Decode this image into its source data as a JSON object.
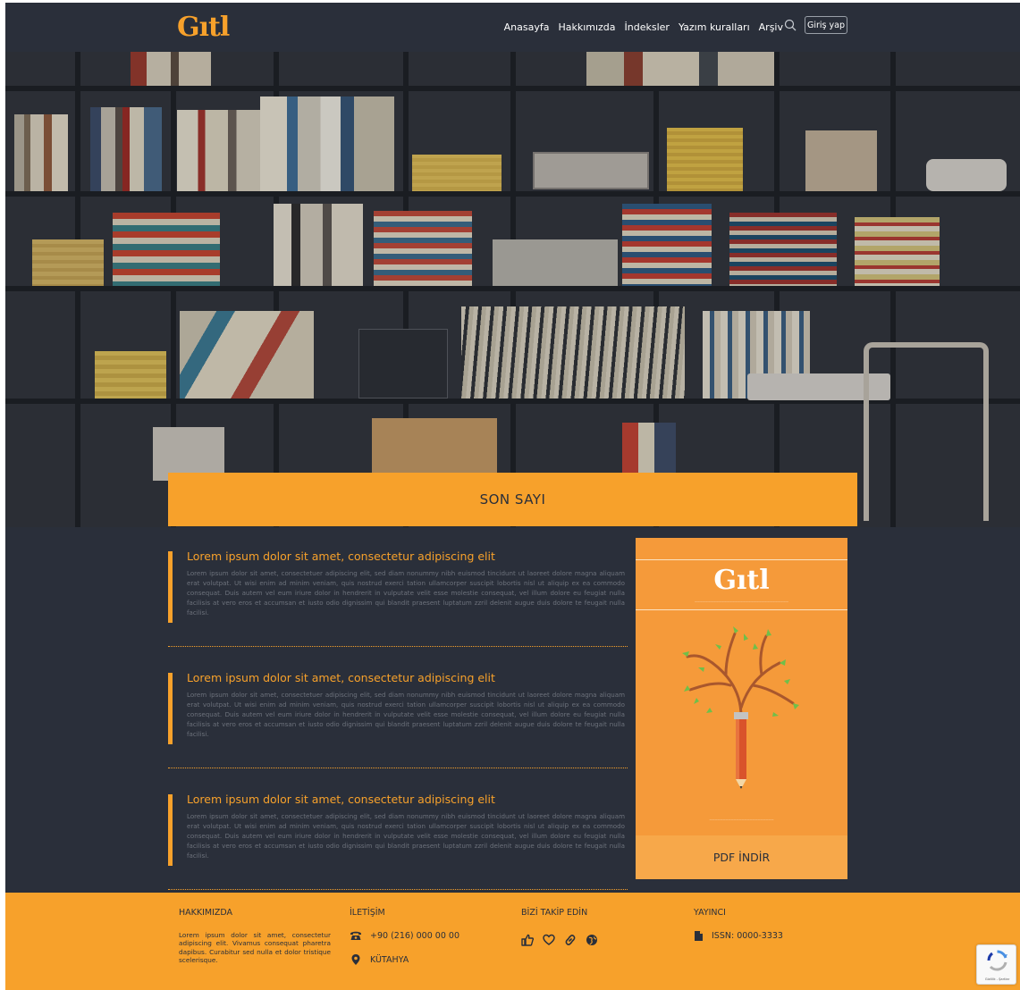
{
  "header": {
    "logo": "Gıtl",
    "nav_items": [
      "Anasayfa",
      "Hakkımızda",
      "İndeksler",
      "Yazım kuralları",
      "Arşiv"
    ],
    "login_label": "Giriş yap"
  },
  "hero": {
    "section_title": "SON SAYI"
  },
  "articles": [
    {
      "title": "Lorem ipsum dolor sit amet, consectetur adipiscing elit",
      "body": "Lorem ipsum dolor sit amet, consectetuer adipiscing elit, sed diam nonummy nibh euismod tincidunt ut laoreet dolore magna aliquam erat volutpat. Ut wisi enim ad minim veniam, quis nostrud exerci tation ullamcorper suscipit lobortis nisl ut aliquip ex ea commodo consequat. Duis autem vel eum iriure dolor in hendrerit in vulputate velit esse molestie consequat, vel illum dolore eu feugiat nulla facilisis at vero eros et accumsan et iusto odio dignissim qui blandit praesent luptatum zzril delenit augue duis dolore te feugait nulla facilisi."
    },
    {
      "title": "Lorem ipsum dolor sit amet, consectetur adipiscing elit",
      "body": "Lorem ipsum dolor sit amet, consectetuer adipiscing elit, sed diam nonummy nibh euismod tincidunt ut laoreet dolore magna aliquam erat volutpat. Ut wisi enim ad minim veniam, quis nostrud exerci tation ullamcorper suscipit lobortis nisl ut aliquip ex ea commodo consequat. Duis autem vel eum iriure dolor in hendrerit in vulputate velit esse molestie consequat, vel illum dolore eu feugiat nulla facilisis at vero eros et accumsan et iusto odio dignissim qui blandit praesent luptatum zzril delenit augue duis dolore te feugait nulla facilisi."
    },
    {
      "title": "Lorem ipsum dolor sit amet, consectetur adipiscing elit",
      "body": "Lorem ipsum dolor sit amet, consectetuer adipiscing elit, sed diam nonummy nibh euismod tincidunt ut laoreet dolore magna aliquam erat volutpat. Ut wisi enim ad minim veniam, quis nostrud exerci tation ullamcorper suscipit lobortis nisl ut aliquip ex ea commodo consequat. Duis autem vel eum iriure dolor in hendrerit in vulputate velit esse molestie consequat, vel illum dolore eu feugiat nulla facilisis at vero eros et accumsan et iusto odio dignissim qui blandit praesent luptatum zzril delenit augue duis dolore te feugait nulla facilisi."
    }
  ],
  "cover": {
    "logo": "Gıtl",
    "pdf_label": "PDF İNDİR"
  },
  "footer": {
    "about": {
      "title": "HAKKIMIZDA",
      "text": "Lorem ipsum dolor sit amet, consectetur adipiscing elit. Vivamus consequat pharetra dapibus. Curabitur sed nulla et dolor tristique scelerisque."
    },
    "contact": {
      "title": "İLETİŞİM",
      "phone": "+90 (216) 000 00 00",
      "location": "KÜTAHYA"
    },
    "social": {
      "title": "BİZİ TAKİP EDİN",
      "icons": [
        "thumbs-up-icon",
        "heart-icon",
        "link-icon",
        "globe-icon"
      ]
    },
    "publisher": {
      "title": "YAYINCI",
      "issn": "ISSN: 0000-3333"
    }
  },
  "recaptcha": {
    "text": "Gizlilik - Şartlar"
  },
  "colors": {
    "accent": "#f7a12b",
    "background": "#2a2f3a",
    "cover": "#f59a3a"
  }
}
